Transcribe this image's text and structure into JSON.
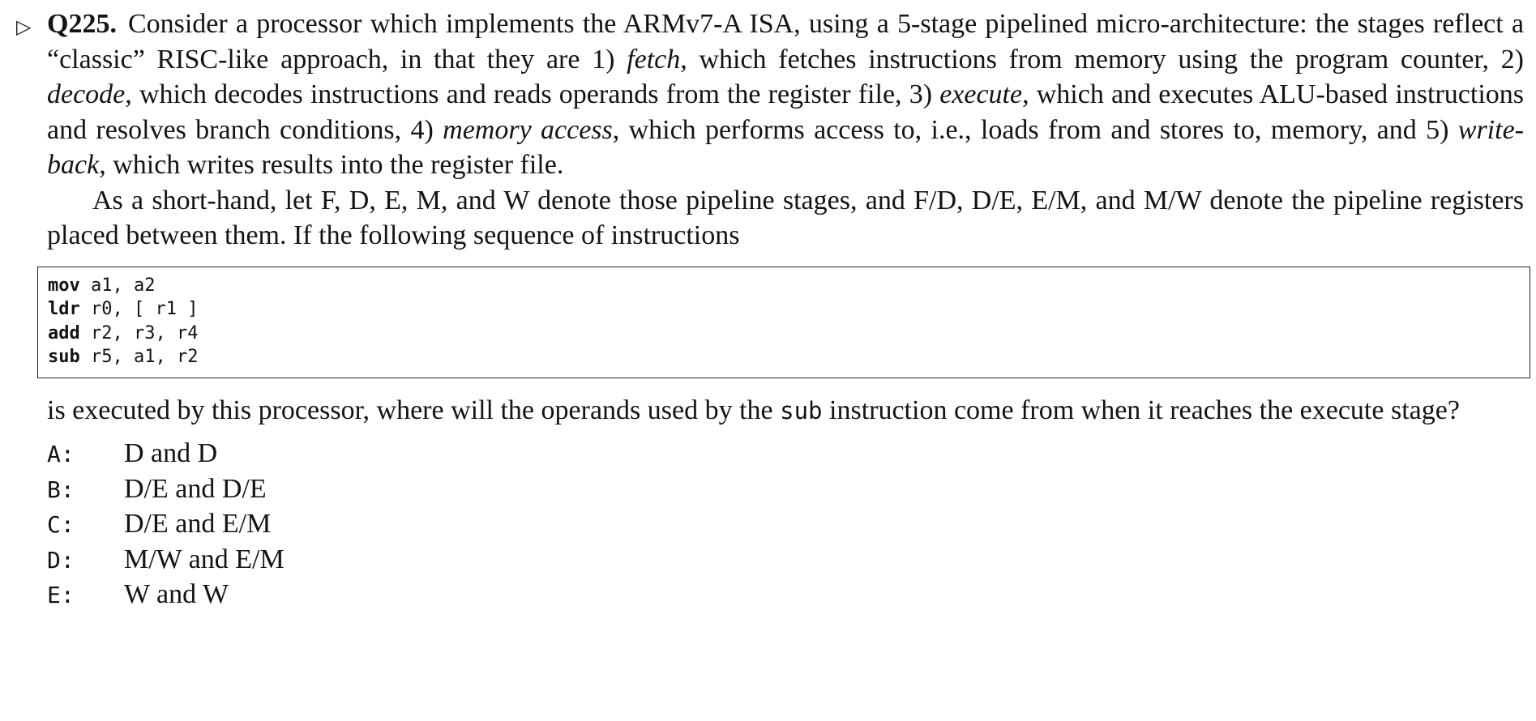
{
  "question": {
    "marker": "▷",
    "number": "Q225.",
    "p1": {
      "t1": "Consider a processor which implements the ARMv7-A ISA, using a 5-stage pipelined micro-architecture: the stages reflect a “classic” RISC-like approach, in that they are 1) ",
      "i1": "fetch",
      "t2": ", which fetches instructions from memory using the program counter, 2) ",
      "i2": "decode",
      "t3": ", which decodes instructions and reads operands from the register file, 3) ",
      "i3": "execute",
      "t4": ", which and executes ALU-based instructions and resolves branch conditions, 4) ",
      "i4": "memory access",
      "t5": ", which performs access to, i.e., loads from and stores to, memory, and 5) ",
      "i5": "write-back",
      "t6": ", which writes results into the register file."
    },
    "p2": "As a short-hand, let F, D, E, M, and W denote those pipeline stages, and F/D, D/E, E/M, and M/W denote the pipeline registers placed between them. If the following sequence of instructions",
    "code": [
      {
        "op": "mov",
        "args": " a1, a2"
      },
      {
        "op": "ldr",
        "args": " r0, [ r1 ]"
      },
      {
        "op": "add",
        "args": " r2, r3, r4"
      },
      {
        "op": "sub",
        "args": " r5, a1, r2"
      }
    ],
    "p3": {
      "t1": "is executed by this processor, where will the operands used by the ",
      "code": "sub",
      "t2": " instruction come from when it reaches the execute stage?"
    },
    "answers": [
      {
        "key": "A:",
        "text": "D and D"
      },
      {
        "key": "B:",
        "text": "D/E and D/E"
      },
      {
        "key": "C:",
        "text": "D/E and E/M"
      },
      {
        "key": "D:",
        "text": "M/W and E/M"
      },
      {
        "key": "E:",
        "text": "W and W"
      }
    ]
  }
}
